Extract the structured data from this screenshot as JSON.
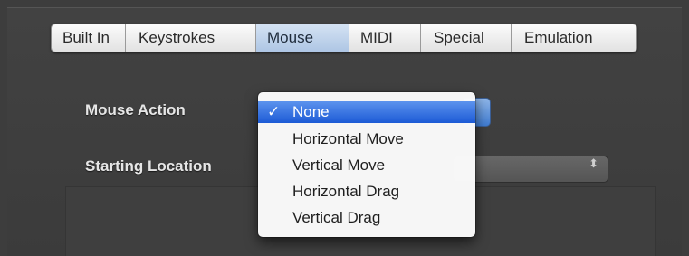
{
  "tabs": [
    {
      "label": "Built In"
    },
    {
      "label": "Keystrokes"
    },
    {
      "label": "Mouse",
      "active": true
    },
    {
      "label": "MIDI"
    },
    {
      "label": "Special"
    },
    {
      "label": "Emulation"
    }
  ],
  "form": {
    "mouse_action_label": "Mouse Action",
    "starting_location_label": "Starting Location",
    "select_arrows": "⬍"
  },
  "menu": {
    "check_mark": "✓",
    "items": [
      {
        "label": "None",
        "selected": true
      },
      {
        "label": "Horizontal Move"
      },
      {
        "label": "Vertical Move"
      },
      {
        "label": "Horizontal Drag"
      },
      {
        "label": "Vertical Drag"
      }
    ]
  },
  "colors": {
    "background": "#3d3d3d",
    "selection": "#2d6be0",
    "active_tab": "#b9cfea"
  }
}
